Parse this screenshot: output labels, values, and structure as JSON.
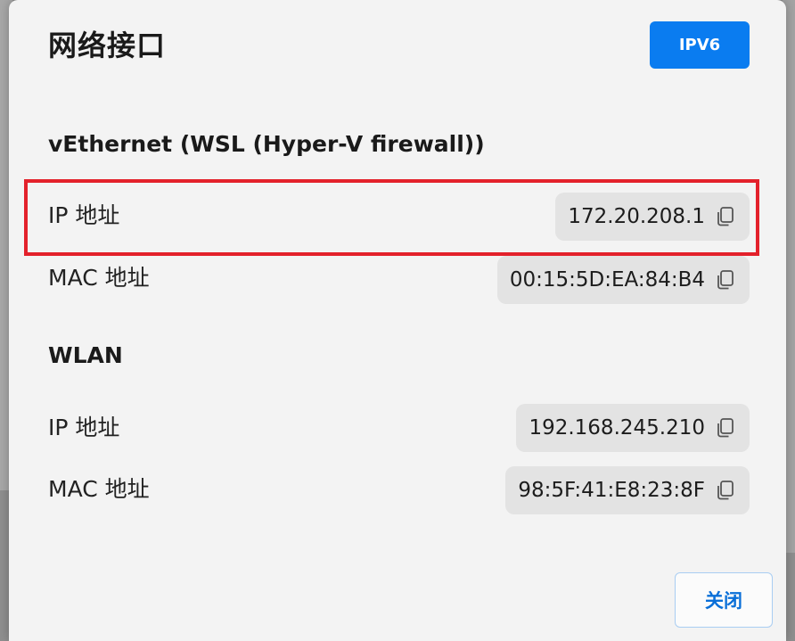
{
  "dialog": {
    "title": "网络接口",
    "ipv6_label": "IPV6",
    "close_label": "关闭"
  },
  "interfaces": [
    {
      "name": "vEthernet (WSL (Hyper-V firewall))",
      "ip_label": "IP 地址",
      "ip_value": "172.20.208.1",
      "mac_label": "MAC 地址",
      "mac_value": "00:15:5D:EA:84:B4"
    },
    {
      "name": "WLAN",
      "ip_label": "IP 地址",
      "ip_value": "192.168.245.210",
      "mac_label": "MAC 地址",
      "mac_value": "98:5F:41:E8:23:8F"
    }
  ],
  "icons": {
    "copy": "copy-icon"
  },
  "colors": {
    "accent": "#0a7cf0",
    "highlight": "#e3212b",
    "pill_bg": "#e3e3e3",
    "dialog_bg": "#f3f3f3"
  }
}
